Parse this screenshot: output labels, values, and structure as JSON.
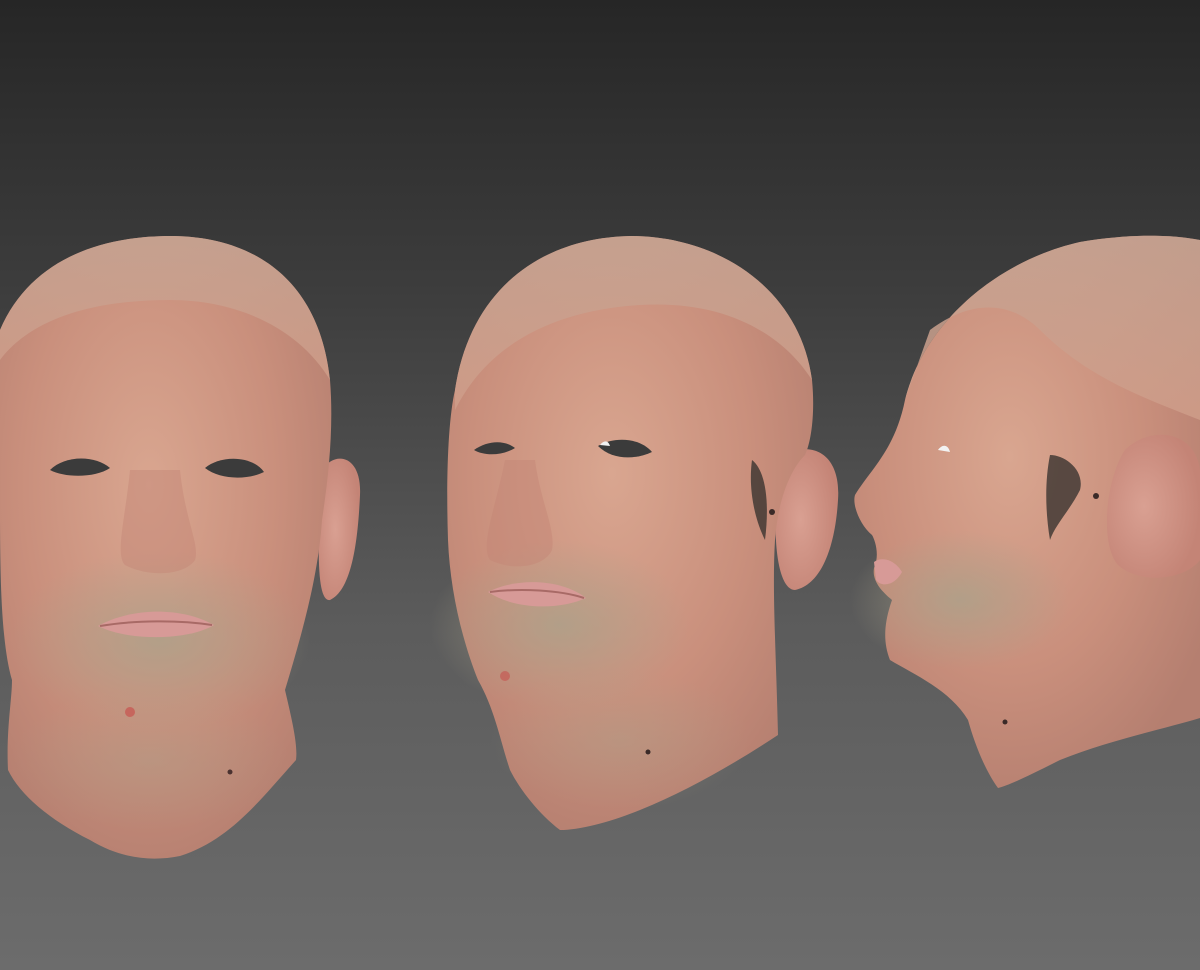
{
  "scene": {
    "background_top": "#262626",
    "background_bottom": "#6c6c6c",
    "views": [
      {
        "name": "front"
      },
      {
        "name": "three-quarter"
      },
      {
        "name": "profile"
      }
    ],
    "skin_color": "#cf9a86",
    "scalp_color": "#c8a28f",
    "lip_color": "#d49893",
    "stubble_color": "#9a9480",
    "eye_hole_color": "#3b3b3b"
  }
}
